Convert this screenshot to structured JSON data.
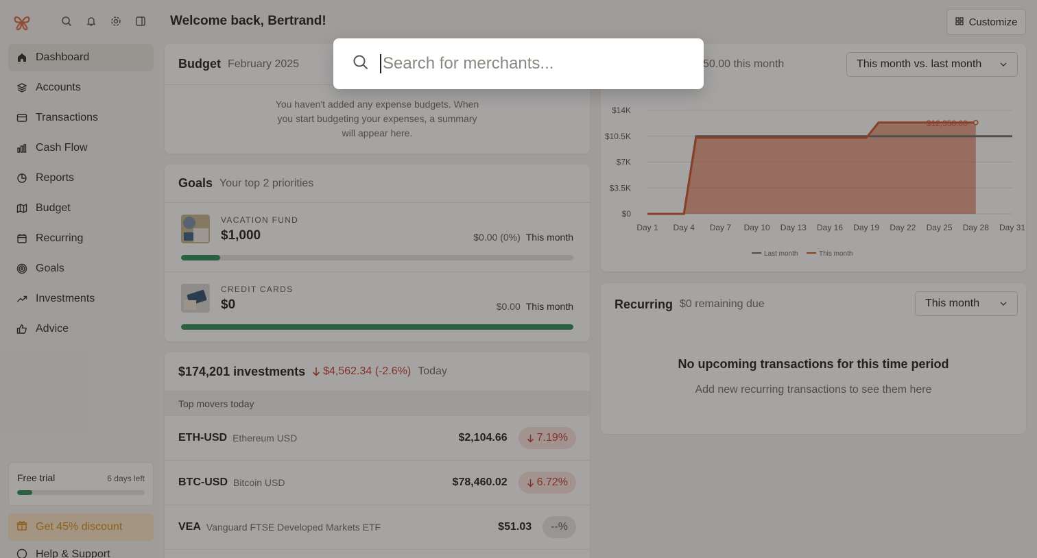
{
  "header": {
    "welcome": "Welcome back, Bertrand!",
    "customize_label": "Customize"
  },
  "sidebar": {
    "items": [
      {
        "label": "Dashboard",
        "icon": "home-icon",
        "active": true
      },
      {
        "label": "Accounts",
        "icon": "layers-icon"
      },
      {
        "label": "Transactions",
        "icon": "credit-card-icon"
      },
      {
        "label": "Cash Flow",
        "icon": "bar-chart-icon"
      },
      {
        "label": "Reports",
        "icon": "pie-chart-icon"
      },
      {
        "label": "Budget",
        "icon": "map-icon"
      },
      {
        "label": "Recurring",
        "icon": "calendar-icon"
      },
      {
        "label": "Goals",
        "icon": "target-icon"
      },
      {
        "label": "Investments",
        "icon": "trending-up-icon"
      },
      {
        "label": "Advice",
        "icon": "thumbs-up-icon"
      }
    ],
    "trial": {
      "title": "Free trial",
      "days_left": "6 days left",
      "progress": 0.12
    },
    "discount_label": "Get 45% discount",
    "help_label": "Help & Support"
  },
  "budget": {
    "title": "Budget",
    "period": "February 2025",
    "empty_message": "You haven't added any expense budgets. When you start budgeting your expenses, a summary will appear here."
  },
  "goals": {
    "title": "Goals",
    "subtitle": "Your top 2 priorities",
    "items": [
      {
        "name": "VACATION FUND",
        "amount": "$1,000",
        "progress_text": "$0.00 (0%)",
        "period": "This month",
        "progress": 0.1
      },
      {
        "name": "CREDIT CARDS",
        "amount": "$0",
        "progress_text": "$0.00",
        "period": "This month",
        "progress": 1.0
      }
    ]
  },
  "investments": {
    "total": "$174,201 investments",
    "change": "$4,562.34 (-2.6%)",
    "period": "Today",
    "movers_header": "Top movers today",
    "movers": [
      {
        "symbol": "ETH-USD",
        "name": "Ethereum USD",
        "price": "$2,104.66",
        "change": "7.19%",
        "direction": "down"
      },
      {
        "symbol": "BTC-USD",
        "name": "Bitcoin USD",
        "price": "$78,460.02",
        "change": "6.72%",
        "direction": "down"
      },
      {
        "symbol": "VEA",
        "name": "Vanguard FTSE Developed Markets ETF",
        "price": "$51.03",
        "change": "--%",
        "direction": "flat"
      }
    ]
  },
  "spending": {
    "subtitle": "50.00 this month",
    "compare_select": "This month vs. last month",
    "colors": {
      "this_month": "#d0532c",
      "last_month": "#6b6b6b"
    }
  },
  "chart_data": {
    "type": "area",
    "x": [
      "Day 1",
      "Day 4",
      "Day 7",
      "Day 10",
      "Day 13",
      "Day 16",
      "Day 19",
      "Day 22",
      "Day 25",
      "Day 28",
      "Day 31"
    ],
    "ylim": [
      0,
      14000
    ],
    "yticks": [
      "$0",
      "$3.5K",
      "$7K",
      "$10.5K",
      "$14K"
    ],
    "series": [
      {
        "name": "Last month",
        "points": [
          [
            1,
            0
          ],
          [
            4,
            0
          ],
          [
            5,
            10500
          ],
          [
            29,
            10500
          ],
          [
            31,
            10500
          ]
        ]
      },
      {
        "name": "This month",
        "points": [
          [
            1,
            0
          ],
          [
            4,
            0
          ],
          [
            5,
            10300
          ],
          [
            16,
            10300
          ],
          [
            19,
            10300
          ],
          [
            20,
            12350
          ],
          [
            28,
            12350
          ]
        ]
      }
    ],
    "annotation": "$12,350.00",
    "legend": [
      "Last month",
      "This month"
    ],
    "legend_position": "bottom"
  },
  "recurring": {
    "title": "Recurring",
    "subtitle": "$0 remaining due",
    "select": "This month",
    "empty_title": "No upcoming transactions for this time period",
    "empty_sub": "Add new recurring transactions to see them here"
  },
  "search": {
    "placeholder": "Search for merchants..."
  }
}
